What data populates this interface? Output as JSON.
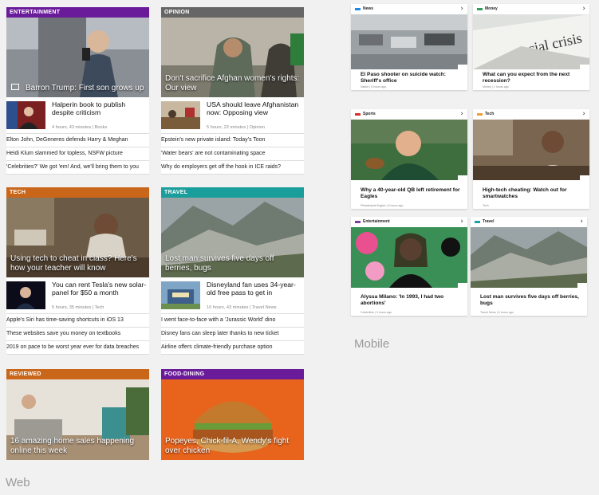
{
  "web": {
    "label": "Web",
    "entertainment": {
      "header": "ENTERTAINMENT",
      "color": "#6a1b9a",
      "hero": "Barron Trump: First son grows up",
      "sub": {
        "title": "Halperin book to publish despite criticism",
        "meta": "4 hours, 43 minutes | Books"
      },
      "lines": [
        "Elton John, DeGeneres defends Harry & Meghan",
        "Heidi Klum slammed for topless, NSFW picture",
        "'Celebrities?' We got 'em! And, we'll bring them to you"
      ]
    },
    "opinion": {
      "header": "OPINION",
      "color": "#666666",
      "hero": "Don't sacrifice Afghan women's rights: Our view",
      "sub": {
        "title": "USA should leave Afghanistan now: Opposing view",
        "meta": "5 hours, 22 minutes | Opinion"
      },
      "lines": [
        "Epstein's new private island: Today's Toon",
        "'Water bears' are not contaminating space",
        "Why do employers get off the hook in ICE raids?"
      ]
    },
    "tech": {
      "header": "TECH",
      "color": "#c9661a",
      "hero": "Using tech to cheat in class? Here's how your teacher will know",
      "sub": {
        "title": "You can rent Tesla's new solar-panel for $50 a month",
        "meta": "5 hours, 35 minutes | Tech"
      },
      "lines": [
        "Apple's Siri has time-saving shortcuts in iOS 13",
        "These websites save you money on textbooks",
        "2019 on pace to be worst year ever for data breaches"
      ]
    },
    "travel": {
      "header": "TRAVEL",
      "color": "#1a9e9c",
      "hero": "Lost man survives five days off berries, bugs",
      "sub": {
        "title": "Disneyland fan uses 34-year-old free pass to get in",
        "meta": "10 hours, 43 minutes | Travel News"
      },
      "lines": [
        "I went face-to-face with a 'Jurassic World' dino",
        "Disney fans can sleep later thanks to new ticket",
        "Airline offers climate-friendly purchase option"
      ]
    },
    "reviewed": {
      "header": "REVIEWED",
      "color": "#c9661a",
      "hero": "16 amazing home sales happening online this week"
    },
    "food": {
      "header": "FOOD-DINING",
      "color": "#6a1b9a",
      "hero": "Popeyes, Chick-fil-A, Wendy's fight over chicken"
    }
  },
  "mobile": {
    "label": "Mobile",
    "cards": [
      {
        "label": "News",
        "color": "#1e88e5",
        "title": "El Paso shooter on suicide watch: Sheriff's office",
        "meta": "Nation | 6 hours ago"
      },
      {
        "label": "Money",
        "color": "#2e9e5a",
        "title": "What can you expect from the next recession?",
        "meta": "Money | 2 hours ago"
      },
      {
        "label": "Sports",
        "color": "#d32f2f",
        "title": "Why a 40-year-old QB left retirement for Eagles",
        "meta": "Philadelphia Eagles | 6 hours ago"
      },
      {
        "label": "Tech",
        "color": "#f39c33",
        "title": "High-tech cheating: Watch out for smartwatches",
        "meta": "Tech"
      },
      {
        "label": "Entertainment",
        "color": "#7b3fa0",
        "title": "Alyssa Milano: 'In 1993, I had two abortions'",
        "meta": "Celebrities | 3 hours ago"
      },
      {
        "label": "Travel",
        "color": "#1aa3a3",
        "title": "Lost man survives five days off berries, bugs",
        "meta": "Travel News | 6 hours ago"
      }
    ]
  },
  "icons": {
    "chevron": "chevron-right-icon",
    "photo": "photo-gallery-icon"
  }
}
